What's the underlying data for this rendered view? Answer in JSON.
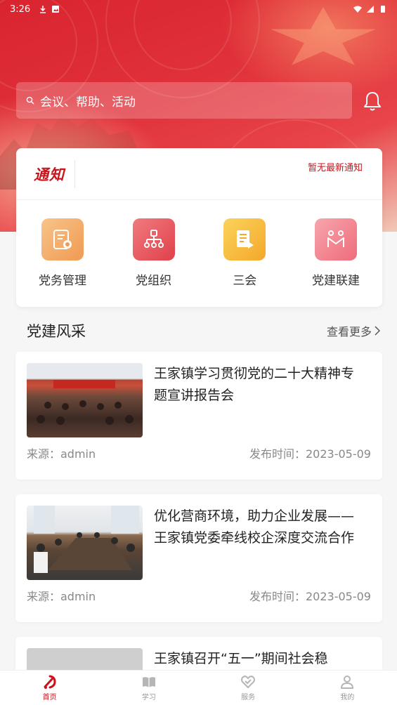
{
  "status_bar": {
    "time": "3:26"
  },
  "search": {
    "placeholder": "会议、帮助、活动"
  },
  "notice": {
    "logo_text": "通知",
    "message": "暂无最新通知"
  },
  "menu": [
    {
      "label": "党务管理",
      "icon": "document-badge-icon",
      "color": "#f3a763"
    },
    {
      "label": "党组织",
      "icon": "org-chart-icon",
      "color": "#e8545a"
    },
    {
      "label": "三会",
      "icon": "meeting-doc-icon",
      "color": "#f6b73c"
    },
    {
      "label": "党建联建",
      "icon": "people-link-icon",
      "color": "#f07b86"
    }
  ],
  "section": {
    "title": "党建风采",
    "more_label": "查看更多"
  },
  "news": [
    {
      "title": "王家镇学习贯彻党的二十大精神专题宣讲报告会",
      "source": "来源：admin",
      "date": "发布时间：2023-05-09"
    },
    {
      "title": "优化营商环境，助力企业发展——王家镇党委牵线校企深度交流合作",
      "source": "来源：admin",
      "date": "发布时间：2023-05-09"
    },
    {
      "title": "王家镇召开“五一”期间社会稳"
    }
  ],
  "tabbar": {
    "home": "首页",
    "study": "学习",
    "service": "服务",
    "mine": "我的"
  },
  "colors": {
    "accent": "#c8151d",
    "hero": "#d9242f"
  }
}
